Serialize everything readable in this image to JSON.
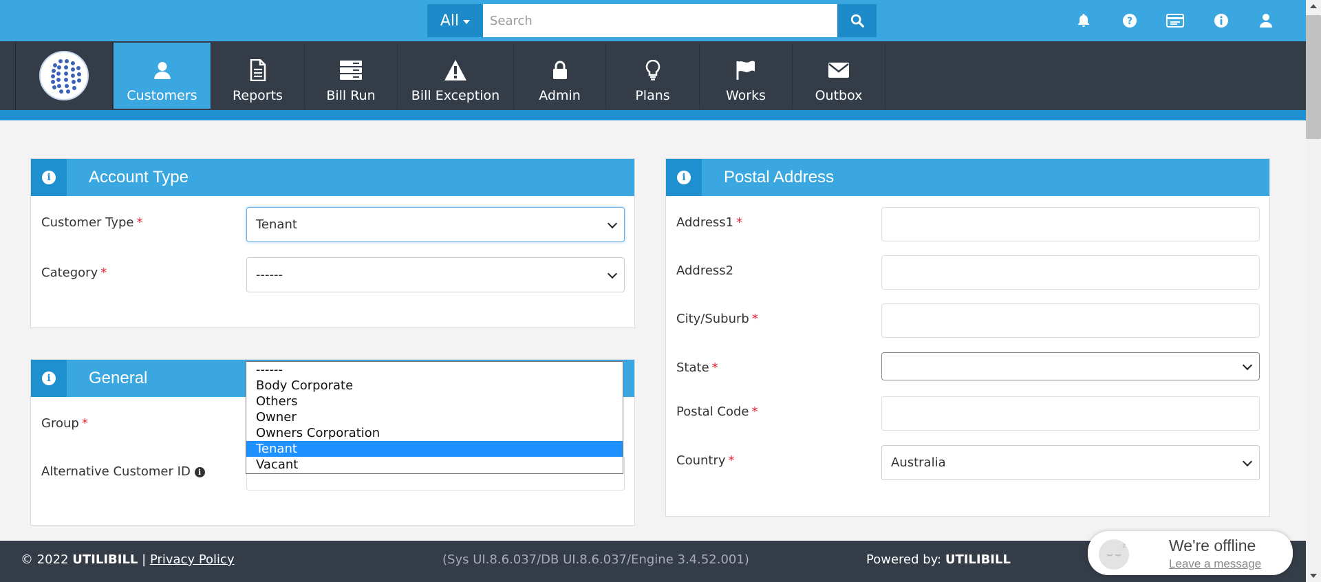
{
  "search": {
    "scope_label": "All",
    "placeholder": "Search",
    "value": ""
  },
  "top_icons": [
    "bell-icon",
    "help-icon",
    "card-icon",
    "info-icon",
    "user-icon"
  ],
  "nav": {
    "items": [
      {
        "label": "Customers",
        "icon": "user-icon",
        "active": true
      },
      {
        "label": "Reports",
        "icon": "document-icon"
      },
      {
        "label": "Bill Run",
        "icon": "server-icon"
      },
      {
        "label": "Bill Exception",
        "icon": "warning-icon"
      },
      {
        "label": "Admin",
        "icon": "lock-icon"
      },
      {
        "label": "Plans",
        "icon": "lightbulb-icon"
      },
      {
        "label": "Works",
        "icon": "flag-icon"
      },
      {
        "label": "Outbox",
        "icon": "envelope-icon"
      }
    ]
  },
  "account_type": {
    "title": "Account Type",
    "customer_type_label": "Customer Type",
    "customer_type_value": "Tenant",
    "category_label": "Category",
    "category_value": "------"
  },
  "general": {
    "title": "General",
    "group_label": "Group",
    "alt_customer_id_label": "Alternative Customer ID"
  },
  "customer_type_options": [
    "------",
    "Body Corporate",
    "Others",
    "Owner",
    "Owners Corporation",
    "Tenant",
    "Vacant"
  ],
  "customer_type_selected_index": 5,
  "postal_address": {
    "title": "Postal Address",
    "address1_label": "Address1",
    "address2_label": "Address2",
    "city_label": "City/Suburb",
    "state_label": "State",
    "state_value": "",
    "postal_code_label": "Postal Code",
    "country_label": "Country",
    "country_value": "Australia"
  },
  "footer": {
    "copyright_prefix": "© 2022",
    "brand": "UTILIBILL",
    "separator": "|",
    "privacy_link": "Privacy Policy",
    "version": "(Sys UI.8.6.037/DB UI.8.6.037/Engine 3.4.52.001)",
    "powered_prefix": "Powered by:",
    "powered_brand": "UTILIBILL"
  },
  "chat": {
    "title": "We're offline",
    "subtitle": "Leave a message"
  },
  "colors": {
    "topbar": "#3aa7e1",
    "navbar": "#343c48",
    "accent_dark": "#1e8fcf",
    "required": "#e5202e",
    "selected_option": "#1e90ff"
  }
}
